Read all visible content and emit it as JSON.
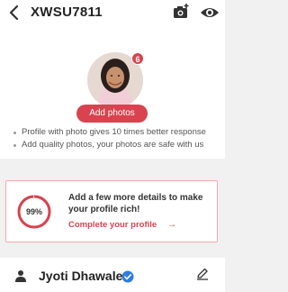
{
  "header": {
    "title": "XWSU7811",
    "back_icon": "back-arrow-icon",
    "camera_icon": "add-photo-camera-icon",
    "view_icon": "eye-icon"
  },
  "profile": {
    "photo_count": "6",
    "add_photos_label": "Add photos",
    "benefits": [
      "Profile with photo gives 10 times better response",
      "Add quality photos, your photos are safe with us"
    ]
  },
  "completion": {
    "percent": "99%",
    "percent_value": 99,
    "message": "Add a few more details to make your profile rich!",
    "link_label": "Complete your profile",
    "link_arrow": "→"
  },
  "user": {
    "name": "Jyoti Dhawale",
    "verified_icon": "verified-check-icon",
    "edit_icon": "edit-icon"
  },
  "colors": {
    "accent": "#d9434f",
    "background": "#f1f1f1",
    "verified_blue": "#2f7de1"
  }
}
